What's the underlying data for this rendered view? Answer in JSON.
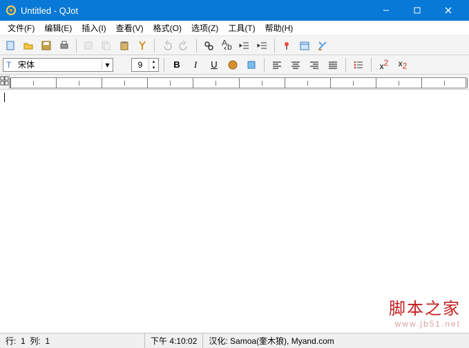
{
  "title": "Untitled - QJot",
  "menu": {
    "file": "文件(F)",
    "edit": "编辑(E)",
    "insert": "插入(I)",
    "view": "查看(V)",
    "format": "格式(O)",
    "options": "选项(Z)",
    "tools": "工具(T)",
    "help": "帮助(H)"
  },
  "font": {
    "name": "宋体",
    "size": "9"
  },
  "status": {
    "line": "行:",
    "lineval": "1",
    "col": "列:",
    "colval": "1",
    "time": "下午 4:10:02",
    "credit": "汉化: Samoa(奎木狼), Myand.com"
  },
  "watermark": {
    "cn": "脚本之家",
    "en": "www.jb51.net"
  }
}
